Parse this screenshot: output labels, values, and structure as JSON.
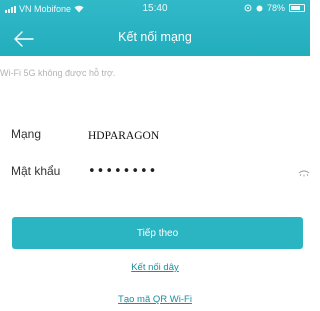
{
  "status_bar": {
    "carrier": "VN Mobifone",
    "time": "15:40",
    "battery": "78%"
  },
  "header": {
    "title": "Kết nối mạng",
    "back_icon": "back-arrow-icon"
  },
  "notice": "Wi-Fi 5G không được hỗ trợ.",
  "form": {
    "network_label": "Mạng",
    "network_value": "HDPARAGON",
    "password_label": "Mật khẩu",
    "password_value": "••••••••"
  },
  "actions": {
    "next_label": "Tiếp theo",
    "wired_link": "Kết nối dây",
    "qr_link": "Tạo mã QR Wi-Fi"
  },
  "colors": {
    "accent": "#2bb4c2",
    "link": "#1a8fa0"
  }
}
